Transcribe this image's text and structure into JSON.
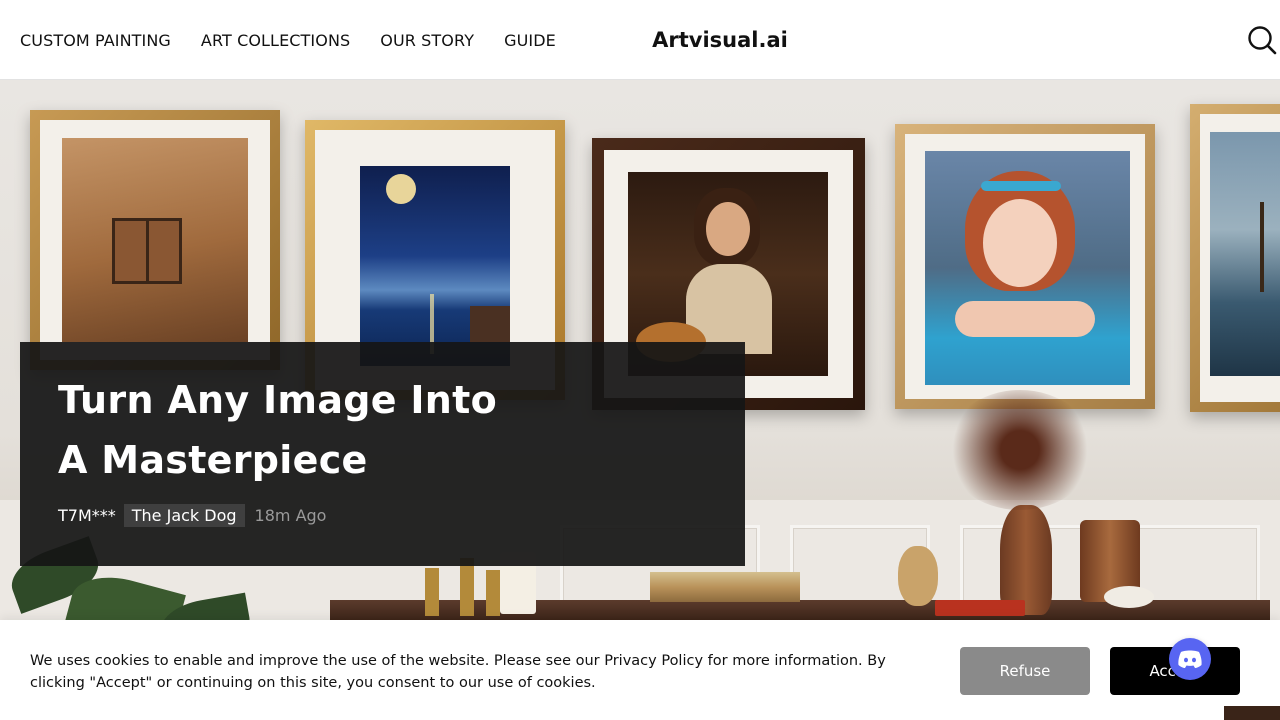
{
  "header": {
    "nav": [
      {
        "label": "CUSTOM PAINTING"
      },
      {
        "label": "ART COLLECTIONS"
      },
      {
        "label": "OUR STORY"
      },
      {
        "label": "GUIDE"
      }
    ],
    "logo": "Artvisual.ai",
    "search_icon": "search-icon"
  },
  "hero": {
    "title_line1": "Turn Any Image Into",
    "title_line2": "A Masterpiece",
    "user": "T7M***",
    "tag": "The Jack Dog",
    "time": "18m Ago"
  },
  "cookie": {
    "text": "We uses cookies to enable and improve the use of the website. Please see our Privacy Policy for more information. By clicking \"Accept\" or continuing on this site, you consent to our use of cookies.",
    "refuse_label": "Refuse",
    "accept_label": "Accept"
  },
  "discord": {
    "icon": "discord-icon"
  },
  "colors": {
    "overlay": "#161616",
    "accept_bg": "#000000",
    "refuse_bg": "#8a8a8a",
    "discord": "#5865f2"
  }
}
